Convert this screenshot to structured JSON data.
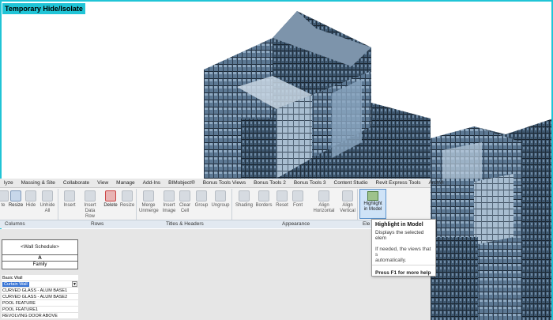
{
  "view": {
    "temp_label": "Temporary Hide/Isolate",
    "accent_color": "#20c4d6"
  },
  "ribbon": {
    "tabs": [
      "lyze",
      "Massing & Site",
      "Collaborate",
      "View",
      "Manage",
      "Add-Ins",
      "BIMobject®",
      "Bonus Tools Views",
      "Bonus Tools 2",
      "Bonus Tools 3",
      "Content Studio",
      "Revit Express Tools",
      "ArchVi"
    ],
    "tools": {
      "delete": "te",
      "resize": "Resize",
      "hide": "Hide",
      "unhide_all": [
        "Unhide",
        "All"
      ],
      "insert": "Insert",
      "insert_data_row": [
        "Insert",
        "Data Row"
      ],
      "delete_row": "Delete",
      "resize_row": "Resize",
      "merge_unmerge": [
        "Merge",
        "Unmerge"
      ],
      "insert_image": [
        "Insert",
        "Image"
      ],
      "clear_cell": [
        "Clear",
        "Cell"
      ],
      "group": "Group",
      "ungroup": "Ungroup",
      "shading": "Shading",
      "borders": "Borders",
      "reset": "Reset",
      "font": "Font",
      "align_horizontal": [
        "Align",
        "Horizontal"
      ],
      "align_vertical": [
        "Align",
        "Vertical"
      ],
      "highlight_in_model": [
        "Highlight",
        "in Model"
      ]
    },
    "panels": {
      "columns": "Columns",
      "rows": "Rows",
      "titles_headers": "Titles & Headers",
      "appearance": "Appearance",
      "element": "Ele"
    }
  },
  "tooltip": {
    "title": "Highlight in Model",
    "text": "Displays the selected elem",
    "more": [
      "If needed, the views that s",
      "automatically."
    ],
    "help": "Press F1 for more help"
  },
  "schedule": {
    "title": "<Wall Schedule>",
    "column_letter": "A",
    "column_header": "Family",
    "group_label": "Basic Wall",
    "selected_value": "Curtain Wall",
    "rows": [
      "CURVED GLASS - ALUM BASE1",
      "CURVED GLASS - ALUM BASE2",
      "POOL FEATURE",
      "POOL FEATURE1",
      "REVOLVING DOOR ABOVE"
    ]
  }
}
